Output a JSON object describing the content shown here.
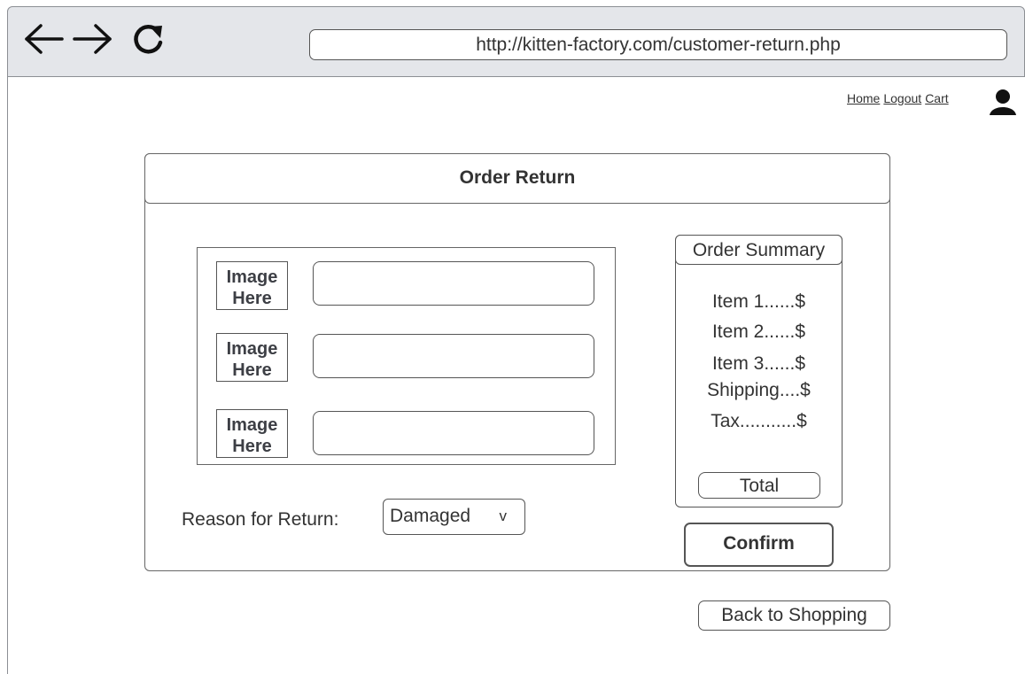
{
  "browser": {
    "url": "http://kitten-factory.com/customer-return.php",
    "icons": [
      "back-arrow-icon",
      "forward-arrow-icon",
      "reload-icon"
    ]
  },
  "top_nav": {
    "links": [
      "Home",
      "Logout",
      "Cart"
    ],
    "user_icon": "user-icon"
  },
  "card": {
    "title": "Order Return"
  },
  "items": [
    {
      "image_line1": "Image",
      "image_line2": "Here",
      "field_value": ""
    },
    {
      "image_line1": "Image",
      "image_line2": "Here",
      "field_value": ""
    },
    {
      "image_line1": "Image",
      "image_line2": "Here",
      "field_value": ""
    }
  ],
  "reason": {
    "label": "Reason for Return:",
    "selected": "Damaged",
    "chevron": "v"
  },
  "summary": {
    "title": "Order Summary",
    "lines": [
      "Item 1......$",
      "Item 2......$",
      "Item 3......$",
      "Shipping....$",
      "Tax...........$"
    ],
    "total_label": "Total"
  },
  "buttons": {
    "confirm": "Confirm",
    "back": "Back to Shopping"
  }
}
